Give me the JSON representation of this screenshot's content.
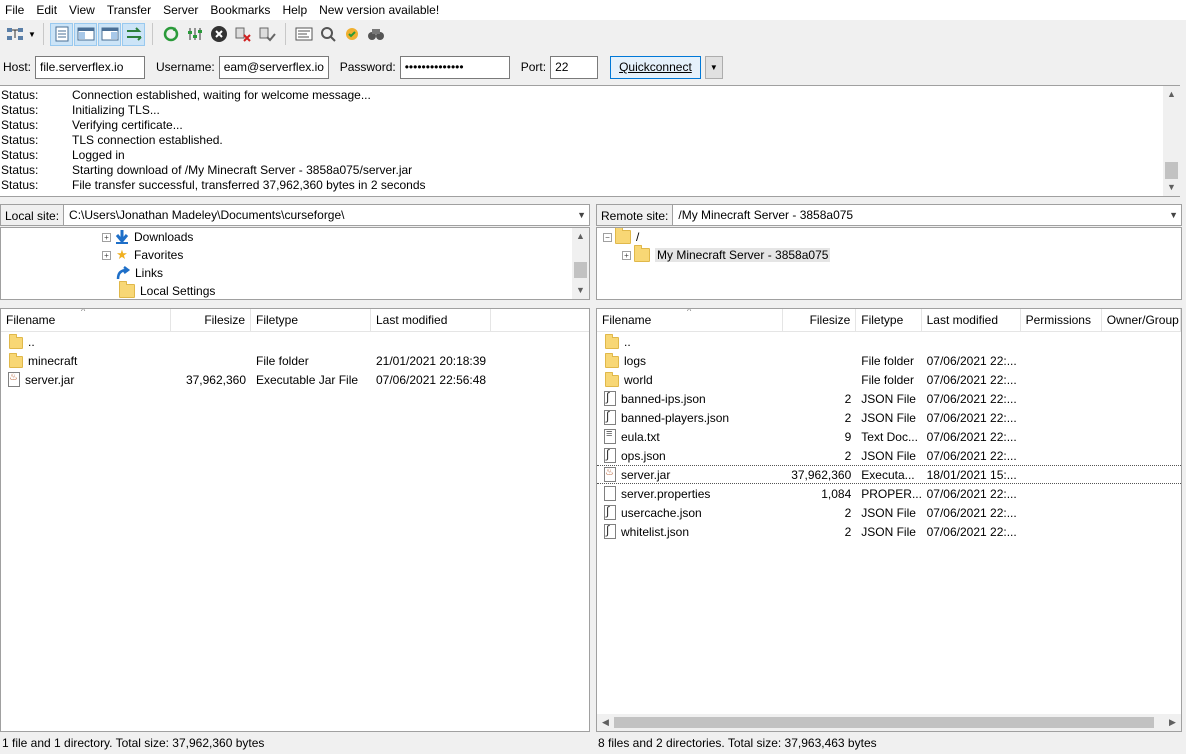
{
  "menu": [
    "File",
    "Edit",
    "View",
    "Transfer",
    "Server",
    "Bookmarks",
    "Help",
    "New version available!"
  ],
  "toolbar": {
    "icons": [
      "site-manager-icon",
      "dropdown-arrow-icon",
      "toggle-message-log-icon",
      "toggle-local-tree-icon",
      "toggle-remote-tree-icon",
      "toggle-transfer-queue-icon",
      "refresh-icon",
      "process-queue-icon",
      "cancel-icon",
      "disconnect-icon",
      "reconnect-icon",
      "directory-listing-filters-icon",
      "compare-icon",
      "sync-browsing-icon",
      "search-icon"
    ]
  },
  "quickconnect": {
    "host_label": "Host:",
    "host_value": "file.serverflex.io",
    "username_label": "Username:",
    "username_value": "eam@serverflex.io",
    "password_label": "Password:",
    "password_value": "••••••••••••••",
    "port_label": "Port:",
    "port_value": "22",
    "button_label": "Quickconnect"
  },
  "log": [
    {
      "type": "Status:",
      "msg": "Connection established, waiting for welcome message..."
    },
    {
      "type": "Status:",
      "msg": "Initializing TLS..."
    },
    {
      "type": "Status:",
      "msg": "Verifying certificate..."
    },
    {
      "type": "Status:",
      "msg": "TLS connection established."
    },
    {
      "type": "Status:",
      "msg": "Logged in"
    },
    {
      "type": "Status:",
      "msg": "Starting download of /My Minecraft Server - 3858a075/server.jar"
    },
    {
      "type": "Status:",
      "msg": "File transfer successful, transferred 37,962,360 bytes in 2 seconds"
    }
  ],
  "local": {
    "site_label": "Local site:",
    "path": "C:\\Users\\Jonathan Madeley\\Documents\\curseforge\\",
    "tree": [
      {
        "label": "Downloads",
        "icon": "download-arrow-icon"
      },
      {
        "label": "Favorites",
        "icon": "star-icon"
      },
      {
        "label": "Links",
        "icon": "link-arrow-icon"
      },
      {
        "label": "Local Settings",
        "icon": "folder-icon"
      }
    ],
    "headers": [
      "Filename",
      "Filesize",
      "Filetype",
      "Last modified"
    ],
    "files": [
      {
        "name": "..",
        "size": "",
        "type": "",
        "modified": "",
        "icon": "folder"
      },
      {
        "name": "minecraft",
        "size": "",
        "type": "File folder",
        "modified": "21/01/2021 20:18:39",
        "icon": "folder"
      },
      {
        "name": "server.jar",
        "size": "37,962,360",
        "type": "Executable Jar File",
        "modified": "07/06/2021 22:56:48",
        "icon": "jar"
      }
    ],
    "status": "1 file and 1 directory. Total size: 37,962,360 bytes"
  },
  "remote": {
    "site_label": "Remote site:",
    "path": "/My Minecraft Server - 3858a075",
    "tree": [
      {
        "label": "/"
      },
      {
        "label": "My Minecraft Server - 3858a075"
      }
    ],
    "headers": [
      "Filename",
      "Filesize",
      "Filetype",
      "Last modified",
      "Permissions",
      "Owner/Group"
    ],
    "files": [
      {
        "name": "..",
        "size": "",
        "type": "",
        "modified": "",
        "icon": "folder"
      },
      {
        "name": "logs",
        "size": "",
        "type": "File folder",
        "modified": "07/06/2021 22:...",
        "icon": "folder"
      },
      {
        "name": "world",
        "size": "",
        "type": "File folder",
        "modified": "07/06/2021 22:...",
        "icon": "folder"
      },
      {
        "name": "banned-ips.json",
        "size": "2",
        "type": "JSON File",
        "modified": "07/06/2021 22:...",
        "icon": "json"
      },
      {
        "name": "banned-players.json",
        "size": "2",
        "type": "JSON File",
        "modified": "07/06/2021 22:...",
        "icon": "json"
      },
      {
        "name": "eula.txt",
        "size": "9",
        "type": "Text Doc...",
        "modified": "07/06/2021 22:...",
        "icon": "txt"
      },
      {
        "name": "ops.json",
        "size": "2",
        "type": "JSON File",
        "modified": "07/06/2021 22:...",
        "icon": "json"
      },
      {
        "name": "server.jar",
        "size": "37,962,360",
        "type": "Executa...",
        "modified": "18/01/2021 15:...",
        "icon": "jar"
      },
      {
        "name": "server.properties",
        "size": "1,084",
        "type": "PROPER...",
        "modified": "07/06/2021 22:...",
        "icon": "blank"
      },
      {
        "name": "usercache.json",
        "size": "2",
        "type": "JSON File",
        "modified": "07/06/2021 22:...",
        "icon": "json"
      },
      {
        "name": "whitelist.json",
        "size": "2",
        "type": "JSON File",
        "modified": "07/06/2021 22:...",
        "icon": "json"
      }
    ],
    "status": "8 files and 2 directories. Total size: 37,963,463 bytes"
  },
  "colors": {
    "accent": "#0078d7",
    "folder": "#f8d775",
    "selection": "#cce4f7"
  }
}
